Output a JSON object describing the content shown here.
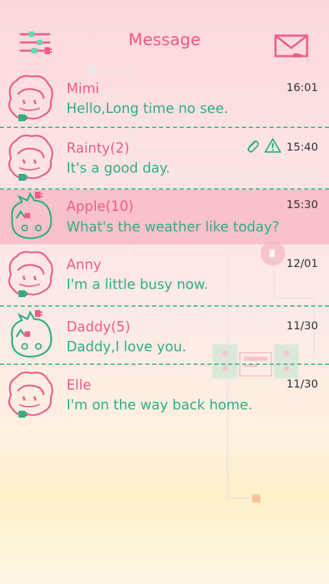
{
  "header": {
    "title": "Message",
    "menu_icon": "sliders-menu-icon",
    "compose_icon": "envelope-compose-icon"
  },
  "colors": {
    "accent_pink": "#ef5c8a",
    "accent_green": "#2fae85",
    "selected_row": "#f6b3be",
    "divider": "#46b98a"
  },
  "conversations": [
    {
      "name": "Mimi",
      "preview": "Hello,Long time no see.",
      "time": "16:01",
      "avatar": "girl-avatar"
    },
    {
      "name": "Rainty(2)",
      "preview": "It's a good day.",
      "time": "15:40",
      "avatar": "girl-avatar",
      "icons": [
        "attachment-icon",
        "warning-icon"
      ]
    },
    {
      "name": "Apple(10)",
      "preview": "What's the weather like today?",
      "time": "15:30",
      "avatar": "boy-avatar",
      "selected": true
    },
    {
      "name": "Anny",
      "preview": "I'm a little busy now.",
      "time": "12/01",
      "avatar": "girl-avatar"
    },
    {
      "name": "Daddy(5)",
      "preview": "Daddy,I love you.",
      "time": "11/30",
      "avatar": "boy-avatar"
    },
    {
      "name": "Elle",
      "preview": "I'm on the way back home.",
      "time": "11/30",
      "avatar": "girl-avatar"
    }
  ]
}
